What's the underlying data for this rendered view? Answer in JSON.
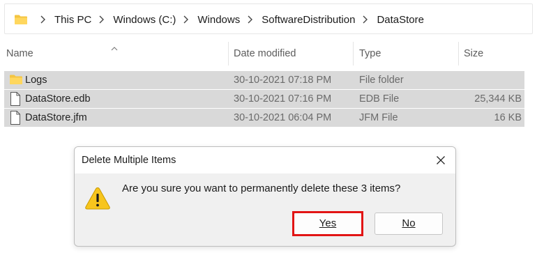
{
  "breadcrumb": {
    "items": [
      "This PC",
      "Windows (C:)",
      "Windows",
      "SoftwareDistribution",
      "DataStore"
    ]
  },
  "columns": {
    "name": "Name",
    "date_modified": "Date modified",
    "type": "Type",
    "size": "Size"
  },
  "files": [
    {
      "name": "Logs",
      "date": "30-10-2021 07:18 PM",
      "type": "File folder",
      "size": "",
      "icon": "folder-icon"
    },
    {
      "name": "DataStore.edb",
      "date": "30-10-2021 07:16 PM",
      "type": "EDB File",
      "size": "25,344 KB",
      "icon": "file-icon"
    },
    {
      "name": "DataStore.jfm",
      "date": "30-10-2021 06:04 PM",
      "type": "JFM File",
      "size": "16 KB",
      "icon": "file-icon"
    }
  ],
  "dialog": {
    "title": "Delete Multiple Items",
    "message": "Are you sure you want to permanently delete these 3 items?",
    "yes_label": "Yes",
    "no_label": "No",
    "icon": "warning-icon"
  },
  "colors": {
    "selection": "#d9d9d9",
    "dialog_bg": "#f0f0f0",
    "highlight": "#e21414",
    "folder": "#f4c542",
    "warning": "#f7c51d"
  }
}
